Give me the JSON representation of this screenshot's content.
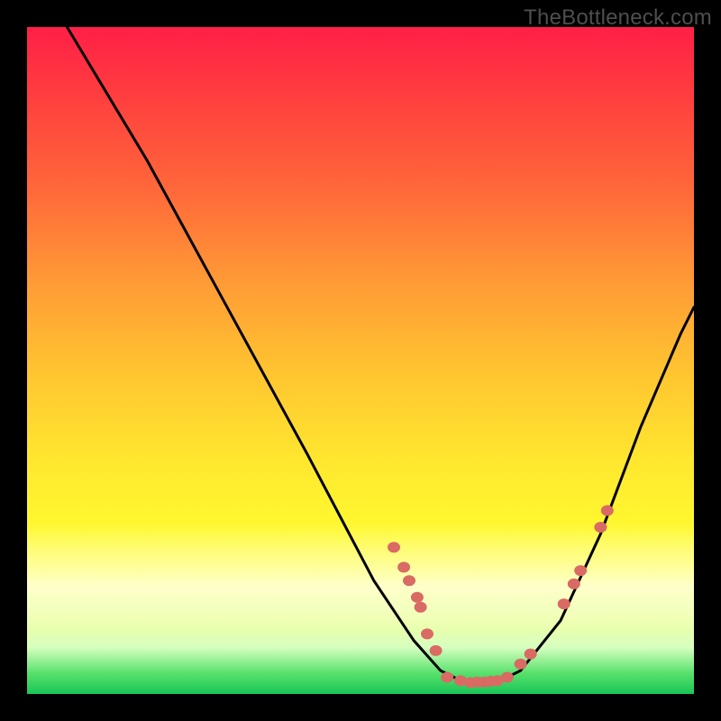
{
  "watermark": "TheBottleneck.com",
  "chart_data": {
    "type": "line",
    "title": "",
    "xlabel": "",
    "ylabel": "",
    "xlim": [
      0,
      100
    ],
    "ylim": [
      0,
      100
    ],
    "curve": [
      {
        "x": 6,
        "y": 100
      },
      {
        "x": 18,
        "y": 80
      },
      {
        "x": 30,
        "y": 58
      },
      {
        "x": 42,
        "y": 36
      },
      {
        "x": 52,
        "y": 17
      },
      {
        "x": 58,
        "y": 8
      },
      {
        "x": 62,
        "y": 3.5
      },
      {
        "x": 66,
        "y": 1.5
      },
      {
        "x": 70,
        "y": 1.5
      },
      {
        "x": 74,
        "y": 3.5
      },
      {
        "x": 80,
        "y": 11
      },
      {
        "x": 86,
        "y": 24
      },
      {
        "x": 92,
        "y": 40
      },
      {
        "x": 98,
        "y": 54
      },
      {
        "x": 100,
        "y": 58
      }
    ],
    "markers": [
      {
        "x": 55.0,
        "y": 22.0
      },
      {
        "x": 56.5,
        "y": 19.0
      },
      {
        "x": 57.3,
        "y": 17.0
      },
      {
        "x": 58.5,
        "y": 14.5
      },
      {
        "x": 59.0,
        "y": 13.0
      },
      {
        "x": 60.0,
        "y": 9.0
      },
      {
        "x": 61.3,
        "y": 6.5
      },
      {
        "x": 63.0,
        "y": 2.5
      },
      {
        "x": 65.0,
        "y": 2.0
      },
      {
        "x": 66.5,
        "y": 1.7
      },
      {
        "x": 67.5,
        "y": 1.8
      },
      {
        "x": 68.5,
        "y": 1.8
      },
      {
        "x": 69.5,
        "y": 1.9
      },
      {
        "x": 70.5,
        "y": 2.0
      },
      {
        "x": 72.0,
        "y": 2.5
      },
      {
        "x": 74.0,
        "y": 4.5
      },
      {
        "x": 75.5,
        "y": 6.0
      },
      {
        "x": 80.5,
        "y": 13.5
      },
      {
        "x": 82.0,
        "y": 16.5
      },
      {
        "x": 83.0,
        "y": 18.5
      },
      {
        "x": 86.0,
        "y": 25.0
      },
      {
        "x": 87.0,
        "y": 27.5
      }
    ],
    "marker_color": "#d96a64",
    "curve_color": "#000000",
    "background_gradient": [
      "#ff1f47",
      "#ffe72f",
      "#18c557"
    ]
  }
}
